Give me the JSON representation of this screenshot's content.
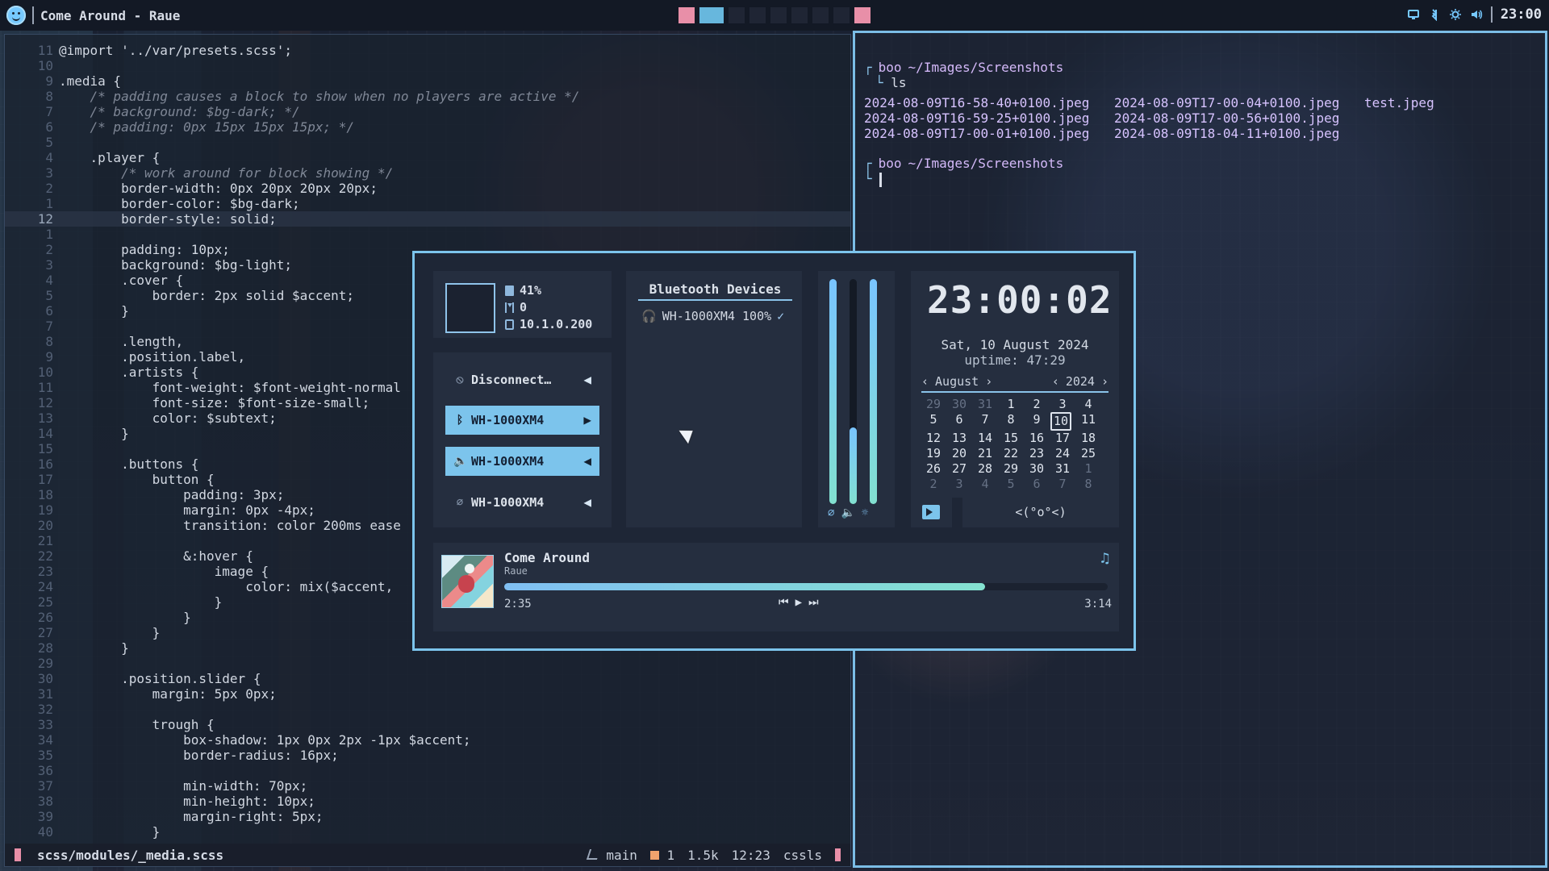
{
  "topbar": {
    "title": "Come Around - Raue",
    "clock": "23:00",
    "icons": [
      "monitor-icon",
      "bluetooth-icon",
      "brightness-icon",
      "volume-icon"
    ]
  },
  "editor": {
    "lines": [
      {
        "n": "11",
        "text": "@import '../var/presets.scss';"
      },
      {
        "n": "10",
        "text": ""
      },
      {
        "n": "9",
        "text": ".media {"
      },
      {
        "n": "8",
        "text": "    /* padding causes a block to show when no players are active */"
      },
      {
        "n": "7",
        "text": "    /* background: $bg-dark; */"
      },
      {
        "n": "6",
        "text": "    /* padding: 0px 15px 15px 15px; */"
      },
      {
        "n": "5",
        "text": ""
      },
      {
        "n": "4",
        "text": "    .player {"
      },
      {
        "n": "3",
        "text": "        /* work around for block showing */"
      },
      {
        "n": "2",
        "text": "        border-width: 0px 20px 20px 20px;"
      },
      {
        "n": "1",
        "text": "        border-color: $bg-dark;"
      },
      {
        "n": "12",
        "text": "        border-style: solid;"
      },
      {
        "n": "1",
        "text": ""
      },
      {
        "n": "2",
        "text": "        padding: 10px;"
      },
      {
        "n": "3",
        "text": "        background: $bg-light;"
      },
      {
        "n": "4",
        "text": "        .cover {"
      },
      {
        "n": "5",
        "text": "            border: 2px solid $accent;"
      },
      {
        "n": "6",
        "text": "        }"
      },
      {
        "n": "7",
        "text": ""
      },
      {
        "n": "8",
        "text": "        .length,"
      },
      {
        "n": "9",
        "text": "        .position.label,"
      },
      {
        "n": "10",
        "text": "        .artists {"
      },
      {
        "n": "11",
        "text": "            font-weight: $font-weight-normal"
      },
      {
        "n": "12",
        "text": "            font-size: $font-size-small;"
      },
      {
        "n": "13",
        "text": "            color: $subtext;"
      },
      {
        "n": "14",
        "text": "        }"
      },
      {
        "n": "15",
        "text": ""
      },
      {
        "n": "16",
        "text": "        .buttons {"
      },
      {
        "n": "17",
        "text": "            button {"
      },
      {
        "n": "18",
        "text": "                padding: 3px;"
      },
      {
        "n": "19",
        "text": "                margin: 0px -4px;"
      },
      {
        "n": "20",
        "text": "                transition: color 200ms ease"
      },
      {
        "n": "21",
        "text": ""
      },
      {
        "n": "22",
        "text": "                &:hover {"
      },
      {
        "n": "23",
        "text": "                    image {"
      },
      {
        "n": "24",
        "text": "                        color: mix($accent,"
      },
      {
        "n": "25",
        "text": "                    }"
      },
      {
        "n": "26",
        "text": "                }"
      },
      {
        "n": "27",
        "text": "            }"
      },
      {
        "n": "28",
        "text": "        }"
      },
      {
        "n": "29",
        "text": ""
      },
      {
        "n": "30",
        "text": "        .position.slider {"
      },
      {
        "n": "31",
        "text": "            margin: 5px 0px;"
      },
      {
        "n": "32",
        "text": ""
      },
      {
        "n": "33",
        "text": "            trough {"
      },
      {
        "n": "34",
        "text": "                box-shadow: 1px 0px 2px -1px $accent;"
      },
      {
        "n": "35",
        "text": "                border-radius: 16px;"
      },
      {
        "n": "36",
        "text": ""
      },
      {
        "n": "37",
        "text": "                min-width: 70px;"
      },
      {
        "n": "38",
        "text": "                min-height: 10px;"
      },
      {
        "n": "39",
        "text": "                margin-right: 5px;"
      },
      {
        "n": "40",
        "text": "            }"
      }
    ],
    "status": {
      "file": "scss/modules/_media.scss",
      "branch": "main",
      "warnings": "1",
      "size": "1.5k",
      "position": "12:23",
      "lang": "cssls"
    }
  },
  "terminal": {
    "prompt_user": "boo",
    "prompt_path": "~/Images/Screenshots",
    "command": "ls",
    "files": [
      "2024-08-09T16-58-40+0100.jpeg",
      "2024-08-09T17-00-04+0100.jpeg",
      "test.jpeg",
      "2024-08-09T16-59-25+0100.jpeg",
      "2024-08-09T17-00-56+0100.jpeg",
      "",
      "2024-08-09T17-00-01+0100.jpeg",
      "2024-08-09T18-04-11+0100.jpeg",
      ""
    ]
  },
  "control_center": {
    "status": {
      "battery": "41%",
      "timer": "0",
      "ip": "10.1.0.200"
    },
    "devices": [
      {
        "label": "Disconnect…",
        "icon": "wifi-off-icon",
        "selected": false
      },
      {
        "label": "WH-1000XM4",
        "icon": "bluetooth-icon",
        "selected": true
      },
      {
        "label": "WH-1000XM4",
        "icon": "speaker-icon",
        "selected": true
      },
      {
        "label": "WH-1000XM4",
        "icon": "microphone-off-icon",
        "selected": false
      }
    ],
    "bluetooth": {
      "title": "Bluetooth Devices",
      "device": "WH-1000XM4 100%"
    },
    "sliders": {
      "mic_level": 1.0,
      "volume_level": 0.34,
      "brightness_level": 1.0
    },
    "clock": {
      "time": "23:00:02",
      "date": "Sat, 10 August 2024",
      "uptime": "uptime: 47:29",
      "month": "August",
      "year": "2024",
      "days": [
        [
          "29",
          "30",
          "31",
          "1",
          "2",
          "3",
          "4"
        ],
        [
          "5",
          "6",
          "7",
          "8",
          "9",
          "10",
          "11"
        ],
        [
          "12",
          "13",
          "14",
          "15",
          "16",
          "17",
          "18"
        ],
        [
          "19",
          "20",
          "21",
          "22",
          "23",
          "24",
          "25"
        ],
        [
          "26",
          "27",
          "28",
          "29",
          "30",
          "31",
          "1"
        ],
        [
          "2",
          "3",
          "4",
          "5",
          "6",
          "7",
          "8"
        ]
      ]
    },
    "face": "<(°o°<)",
    "player": {
      "title": "Come Around",
      "artist": "Raue",
      "elapsed": "2:35",
      "duration": "3:14",
      "progress": 0.797
    }
  }
}
